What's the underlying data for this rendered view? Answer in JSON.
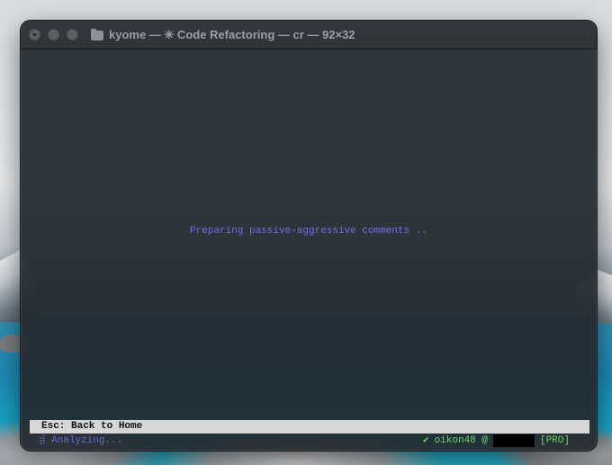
{
  "window": {
    "title": "kyome — ✳ Code Refactoring — cr — 92×32"
  },
  "terminal": {
    "loading_message": "Preparing passive-aggressive comments ..",
    "esc_hint": "Esc: Back to Home",
    "status": {
      "spinner_glyph": "⣾",
      "analyzing": "Analyzing...",
      "check_glyph": "✔",
      "user": "oikon48 @",
      "plan": "[PRO]"
    }
  },
  "colors": {
    "accent_purple": "#7a69e6",
    "status_green": "#6bd46b",
    "hint_bar": "#d7d7d7"
  }
}
